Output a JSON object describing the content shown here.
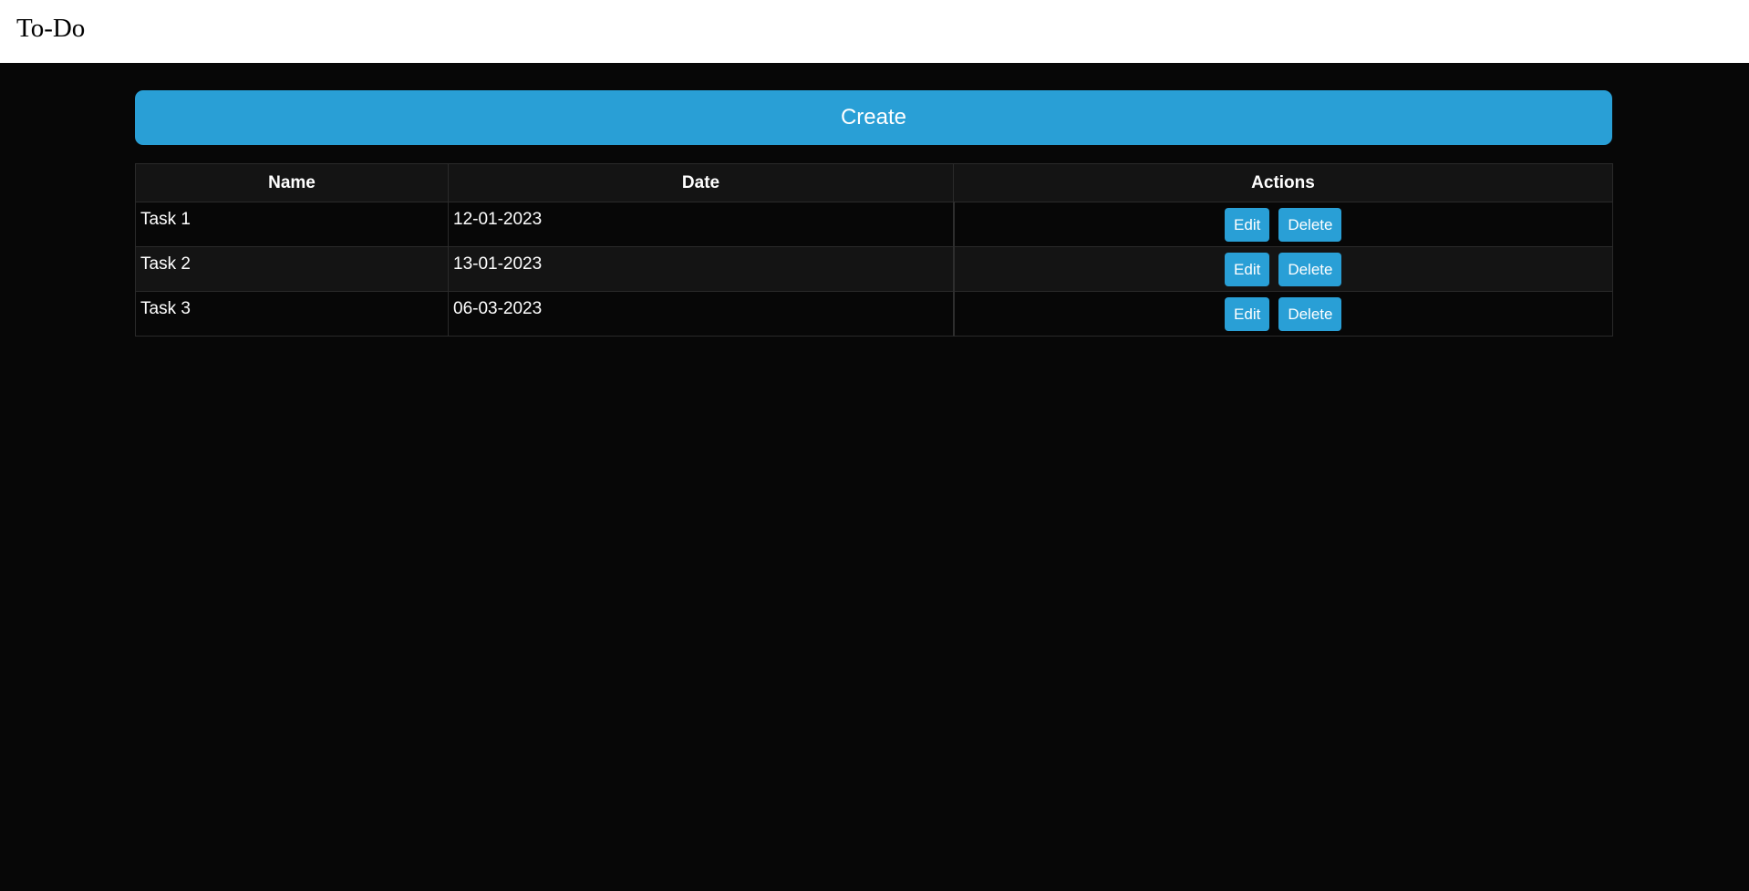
{
  "header": {
    "title": "To-Do"
  },
  "main": {
    "create_label": "Create"
  },
  "table": {
    "columns": [
      "Name",
      "Date",
      "Actions"
    ],
    "rows": [
      {
        "name": "Task 1",
        "date": "12-01-2023",
        "edit_label": "Edit",
        "delete_label": "Delete"
      },
      {
        "name": "Task 2",
        "date": "13-01-2023",
        "edit_label": "Edit",
        "delete_label": "Delete"
      },
      {
        "name": "Task 3",
        "date": "06-03-2023",
        "edit_label": "Edit",
        "delete_label": "Delete"
      }
    ]
  },
  "colors": {
    "accent": "#299fd6",
    "background": "#070707",
    "header_bar": "#ffffff"
  }
}
